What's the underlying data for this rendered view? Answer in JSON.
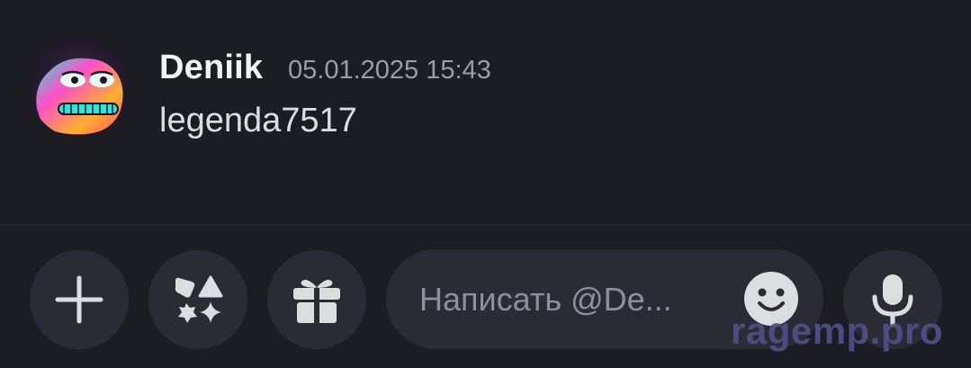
{
  "message": {
    "author": "Deniik",
    "timestamp": "05.01.2025 15:43",
    "text": "legenda7517"
  },
  "composer": {
    "placeholder": "Написать @De...",
    "buttons": [
      "plus-icon",
      "apps-icon",
      "gift-icon",
      "emoji-icon",
      "microphone-icon"
    ]
  },
  "watermark": "ragemp.pro",
  "colors": {
    "background": "#1c1d22",
    "button": "#2b2c33",
    "text": "#dcdde1",
    "muted": "#9a9ca6"
  }
}
